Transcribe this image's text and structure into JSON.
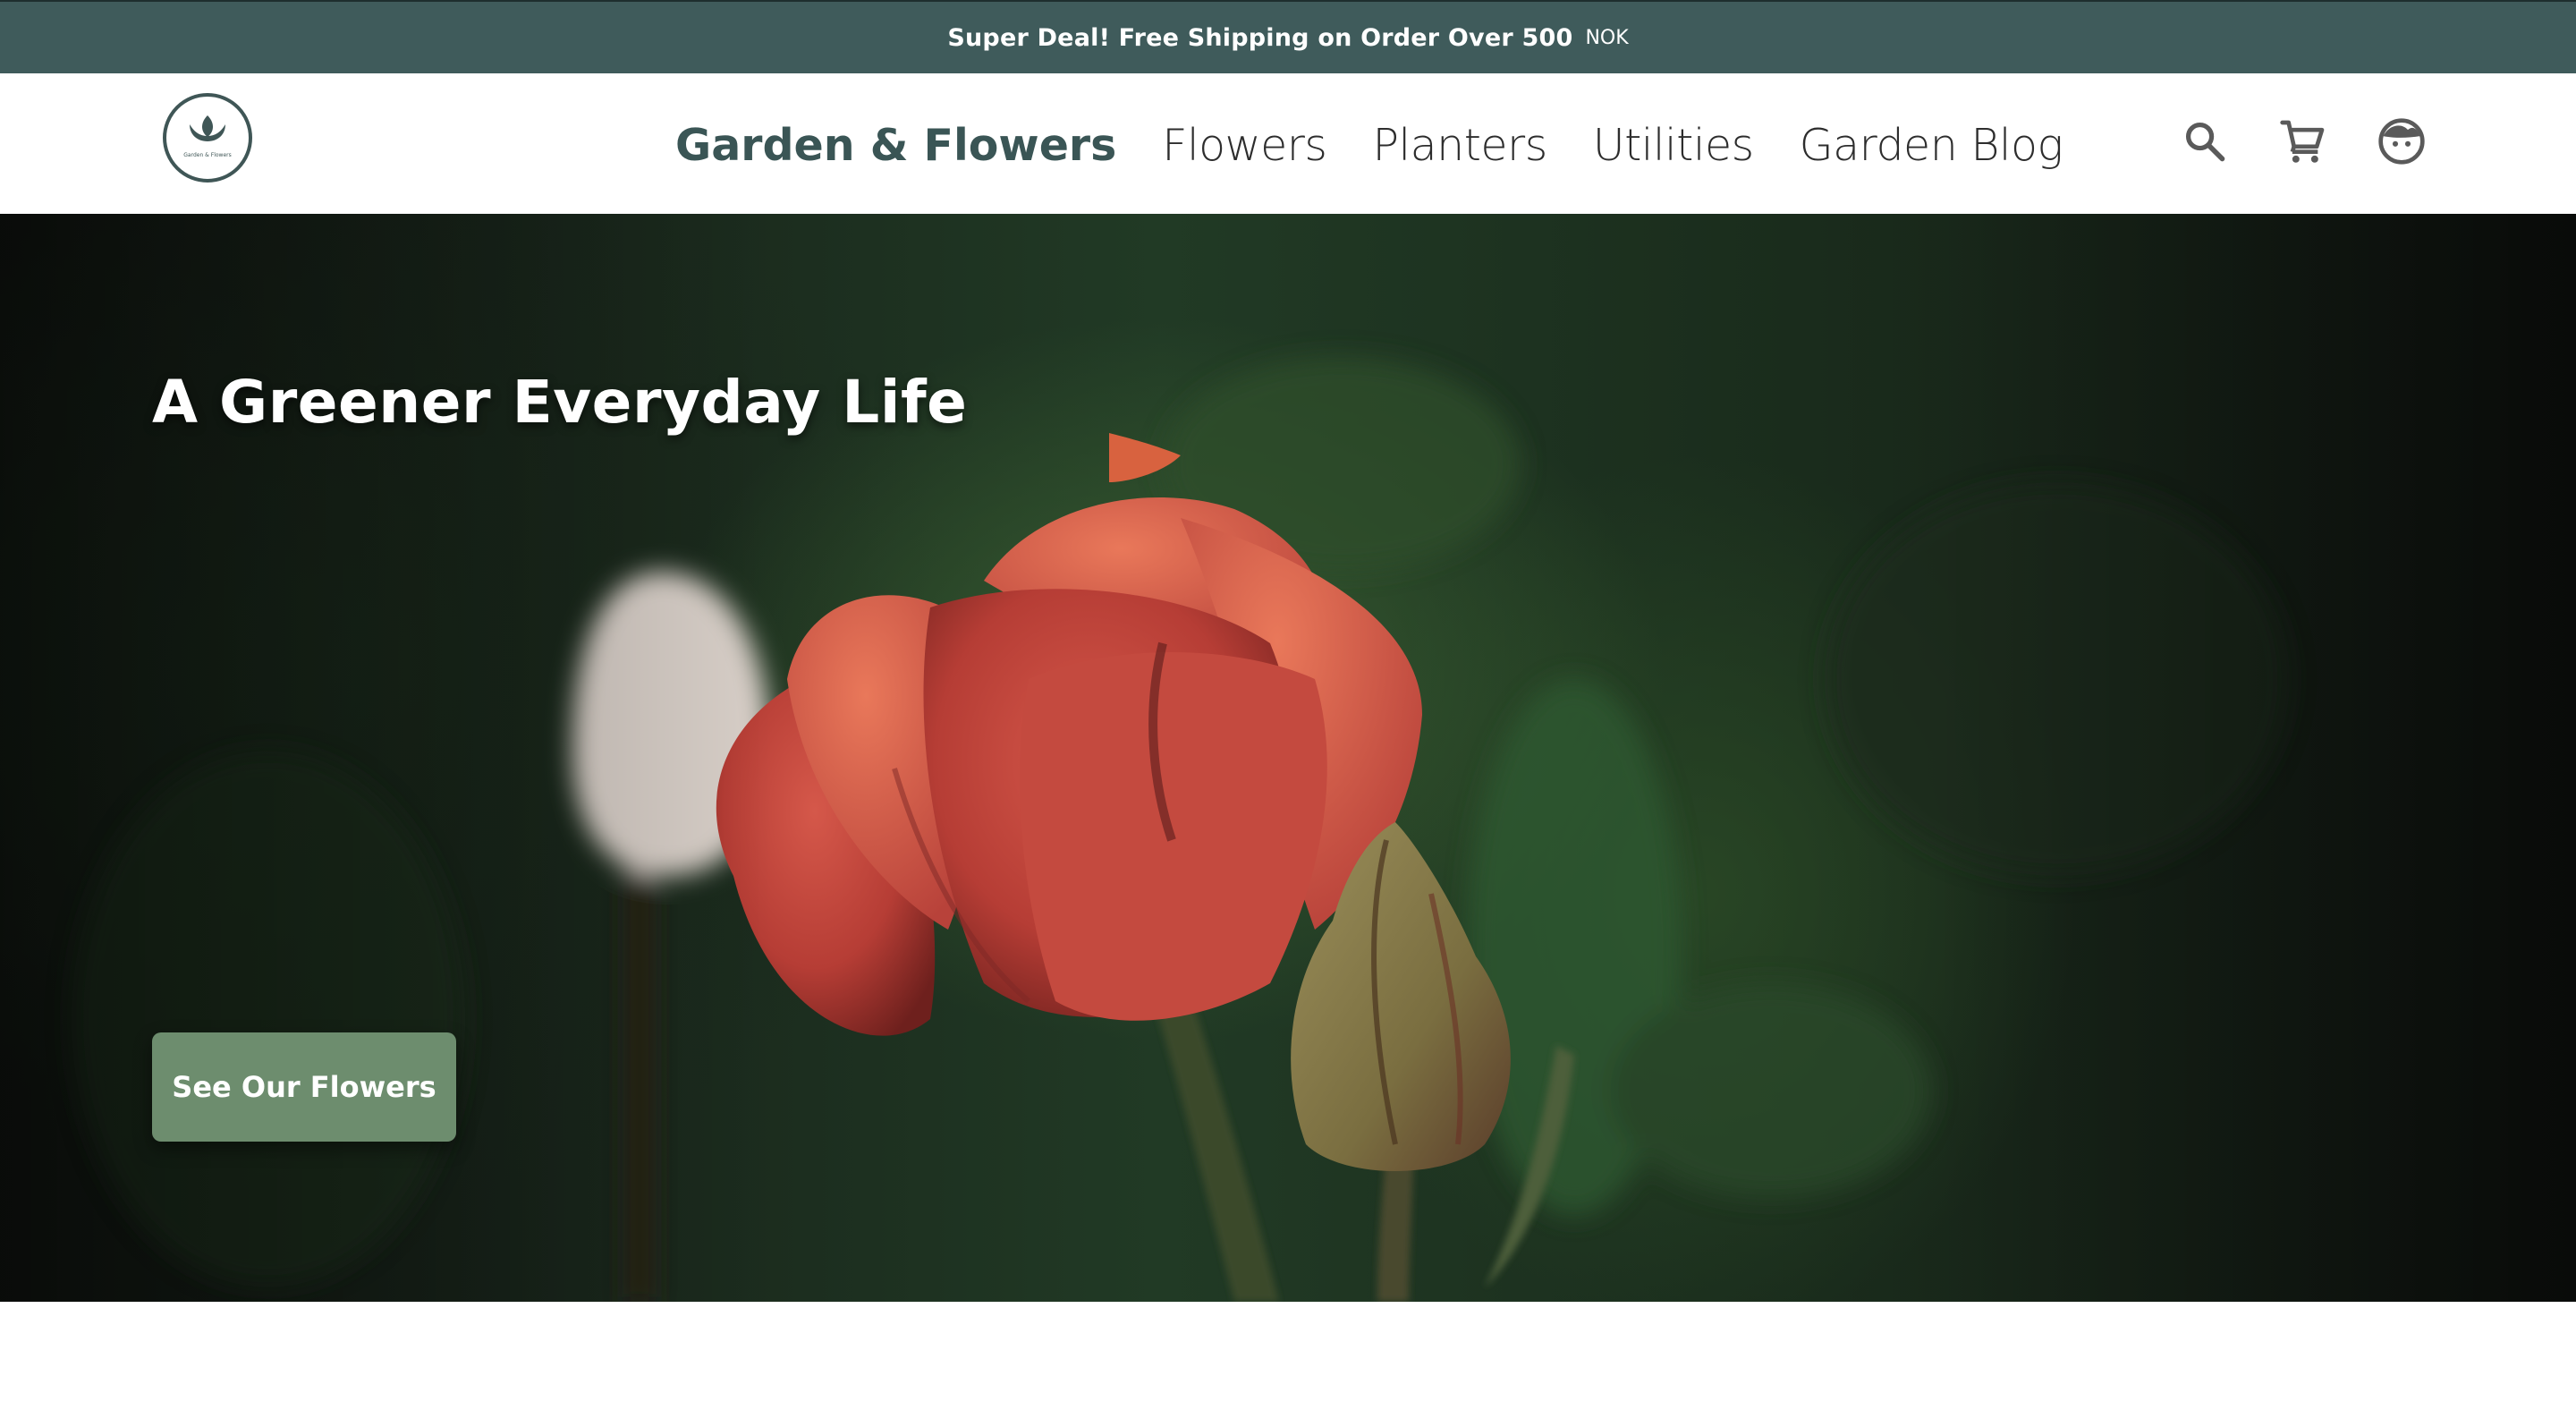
{
  "promo": {
    "text": "Super Deal! Free Shipping on Order Over 500",
    "currency": "NOK"
  },
  "header": {
    "logo_caption": "Garden & Flowers",
    "nav": [
      {
        "label": "Garden & Flowers"
      },
      {
        "label": "Flowers"
      },
      {
        "label": "Planters"
      },
      {
        "label": "Utilities"
      },
      {
        "label": "Garden Blog"
      }
    ],
    "icons": [
      "search-icon",
      "cart-icon",
      "account-icon"
    ]
  },
  "hero": {
    "title": "A Greener Everyday Life",
    "cta_label": "See Our Flowers"
  },
  "colors": {
    "promo_bg": "#3f5b5b",
    "brand": "#3a5555",
    "cta_bg": "#6d8d6e",
    "hero_bg": "#1c2e1e"
  }
}
